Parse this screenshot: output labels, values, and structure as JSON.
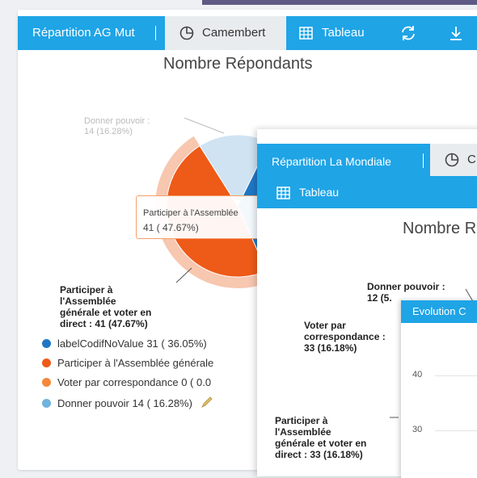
{
  "panel1": {
    "tabs": {
      "title": "Répartition AG Mut",
      "pie_tab": "Camembert",
      "table_tab": "Tableau"
    },
    "chart_title": "Nombre Répondants",
    "slice_labels": {
      "donner_line1": "Donner pouvoir :",
      "donner_line2": "14 (16.28%)"
    },
    "tooltip": {
      "line1": "Participer à l'Assemblée",
      "line2": "41 ( 47.67%)"
    },
    "bold_label": [
      "Participer à",
      "l'Assemblée",
      "générale et voter en",
      "direct : 41 (47.67%)"
    ],
    "legend": [
      {
        "label": "labelCodifNoValue 31 ( 36.05%)",
        "color": "#1f77c4"
      },
      {
        "label": "Participer à l'Assemblée générale",
        "color": "#ee5a18"
      },
      {
        "label": "Voter par correspondance 0 ( 0.0",
        "color": "#f5883a"
      },
      {
        "label": "Donner pouvoir 14 ( 16.28%)",
        "color": "#6fb3de"
      }
    ]
  },
  "panel2": {
    "tabs": {
      "title": "Répartition La Mondiale",
      "table_tab": "Tableau"
    },
    "chart_title": "Nombre R",
    "labels": {
      "donner": [
        "Donner pouvoir :",
        "12 (5."
      ],
      "voter": [
        "Voter par",
        "correspondance :",
        "33 (16.18%)"
      ],
      "participer": [
        "Participer à",
        "l'Assemblée",
        "générale et voter en",
        "direct : 33 (16.18%)"
      ]
    }
  },
  "panel3": {
    "title": "Evolution C",
    "yticks": [
      "40",
      "30"
    ]
  },
  "chart_data": {
    "type": "pie",
    "title": "Nombre Répondants",
    "categories": [
      "labelCodifNoValue",
      "Participer à l'Assemblée générale et voter en direct",
      "Voter par correspondance",
      "Donner pouvoir"
    ],
    "values": [
      31,
      41,
      0,
      14
    ],
    "percentages": [
      36.05,
      47.67,
      0.0,
      16.28
    ],
    "colors": [
      "#1f77c4",
      "#ee5a18",
      "#f5883a",
      "#cfe3f3"
    ]
  }
}
